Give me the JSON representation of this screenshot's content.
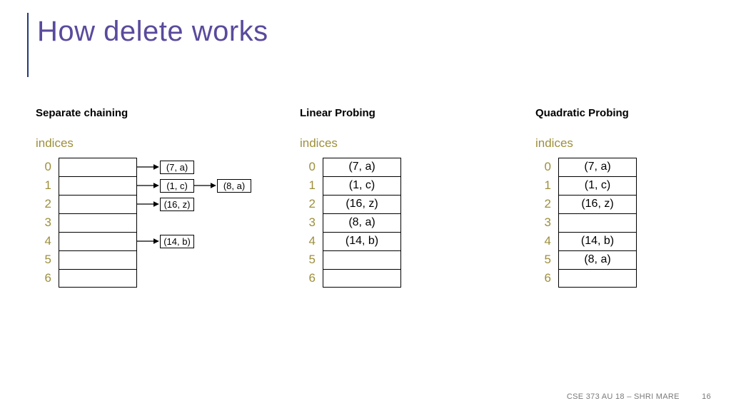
{
  "title": "How delete works",
  "indices_word": "indices",
  "footer": {
    "course": "CSE 373 AU 18 – SHRI MARE",
    "page": "16"
  },
  "separate_chaining": {
    "heading": "Separate chaining",
    "indices": [
      "0",
      "1",
      "2",
      "3",
      "4",
      "5",
      "6"
    ],
    "chains": {
      "0": [
        "(7, a)"
      ],
      "1": [
        "(1, c)",
        "(8, a)"
      ],
      "2": [
        "(16, z)"
      ],
      "4": [
        "(14, b)"
      ]
    }
  },
  "linear_probing": {
    "heading": "Linear Probing",
    "indices": [
      "0",
      "1",
      "2",
      "3",
      "4",
      "5",
      "6"
    ],
    "cells": [
      "(7, a)",
      "(1, c)",
      "(16, z)",
      "(8, a)",
      "(14, b)",
      "",
      ""
    ]
  },
  "quadratic_probing": {
    "heading": "Quadratic Probing",
    "indices": [
      "0",
      "1",
      "2",
      "3",
      "4",
      "5",
      "6"
    ],
    "cells": [
      "(7, a)",
      "(1, c)",
      "(16, z)",
      "",
      "(14, b)",
      "(8, a)",
      ""
    ]
  },
  "chart_data": [
    {
      "type": "table",
      "title": "Separate chaining",
      "categories": [
        "0",
        "1",
        "2",
        "3",
        "4",
        "5",
        "6"
      ],
      "series": [
        {
          "name": "chain-node-1",
          "values": [
            "(7, a)",
            "(1, c)",
            "(16, z)",
            "",
            "(14, b)",
            "",
            ""
          ]
        },
        {
          "name": "chain-node-2",
          "values": [
            "",
            "(8, a)",
            "",
            "",
            "",
            "",
            ""
          ]
        }
      ]
    },
    {
      "type": "table",
      "title": "Linear Probing",
      "categories": [
        "0",
        "1",
        "2",
        "3",
        "4",
        "5",
        "6"
      ],
      "values": [
        "(7, a)",
        "(1, c)",
        "(16, z)",
        "(8, a)",
        "(14, b)",
        "",
        ""
      ]
    },
    {
      "type": "table",
      "title": "Quadratic Probing",
      "categories": [
        "0",
        "1",
        "2",
        "3",
        "4",
        "5",
        "6"
      ],
      "values": [
        "(7, a)",
        "(1, c)",
        "(16, z)",
        "",
        "(14, b)",
        "(8, a)",
        ""
      ]
    }
  ]
}
